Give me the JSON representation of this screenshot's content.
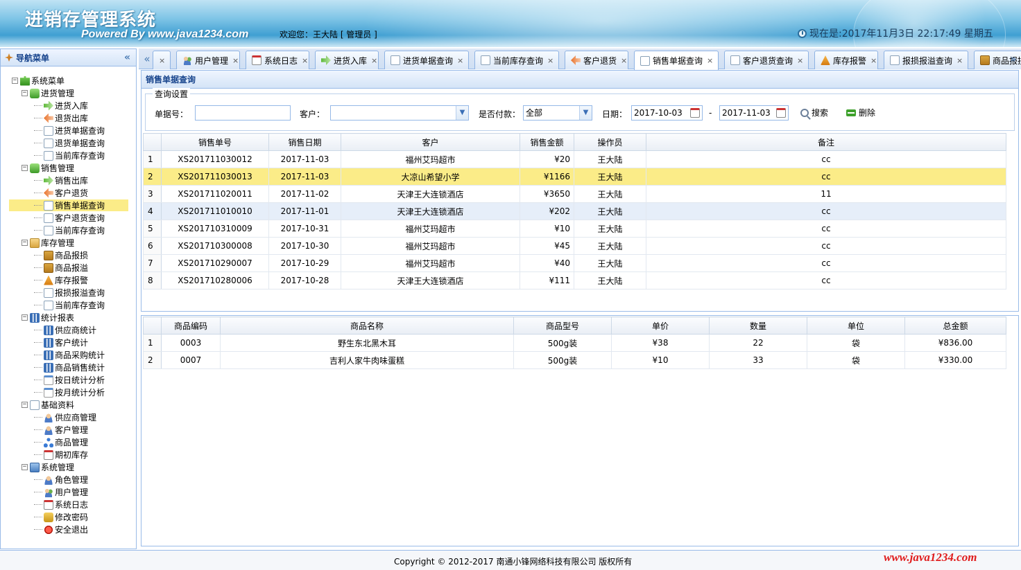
{
  "header": {
    "app_title": "进销存管理系统",
    "powered_by": "Powered By www.java1234.com",
    "welcome": "欢迎您：王大陆 [ 管理员 ]",
    "clock": "现在是:2017年11月3日 22:17:49 星期五"
  },
  "nav": {
    "title": "导航菜单",
    "collapse_icon": "«",
    "tree": [
      {
        "label": "系统菜单",
        "level": 0,
        "icon": "puzzle",
        "toggle": "⊟"
      },
      {
        "label": "进货管理",
        "level": 1,
        "icon": "green",
        "toggle": "⊟"
      },
      {
        "label": "进货入库",
        "level": 2,
        "icon": "in"
      },
      {
        "label": "退货出库",
        "level": 2,
        "icon": "out"
      },
      {
        "label": "进货单据查询",
        "level": 2,
        "icon": "doc"
      },
      {
        "label": "退货单据查询",
        "level": 2,
        "icon": "doc"
      },
      {
        "label": "当前库存查询",
        "level": 2,
        "icon": "doc"
      },
      {
        "label": "销售管理",
        "level": 1,
        "icon": "green",
        "toggle": "⊟"
      },
      {
        "label": "销售出库",
        "level": 2,
        "icon": "in"
      },
      {
        "label": "客户退货",
        "level": 2,
        "icon": "out"
      },
      {
        "label": "销售单据查询",
        "level": 2,
        "icon": "doc",
        "selected": true
      },
      {
        "label": "客户退货查询",
        "level": 2,
        "icon": "doc"
      },
      {
        "label": "当前库存查询",
        "level": 2,
        "icon": "doc"
      },
      {
        "label": "库存管理",
        "level": 1,
        "icon": "folder",
        "toggle": "⊟"
      },
      {
        "label": "商品报损",
        "level": 2,
        "icon": "pkg"
      },
      {
        "label": "商品报溢",
        "level": 2,
        "icon": "pkg"
      },
      {
        "label": "库存报警",
        "level": 2,
        "icon": "warn"
      },
      {
        "label": "报损报溢查询",
        "level": 2,
        "icon": "doc"
      },
      {
        "label": "当前库存查询",
        "level": 2,
        "icon": "doc"
      },
      {
        "label": "统计报表",
        "level": 1,
        "icon": "chart",
        "toggle": "⊟"
      },
      {
        "label": "供应商统计",
        "level": 2,
        "icon": "chart"
      },
      {
        "label": "客户统计",
        "level": 2,
        "icon": "chart"
      },
      {
        "label": "商品采购统计",
        "level": 2,
        "icon": "chart"
      },
      {
        "label": "商品销售统计",
        "level": 2,
        "icon": "chart"
      },
      {
        "label": "按日统计分析",
        "level": 2,
        "icon": "cal2"
      },
      {
        "label": "按月统计分析",
        "level": 2,
        "icon": "cal2"
      },
      {
        "label": "基础资料",
        "level": 1,
        "icon": "doc",
        "toggle": "⊟"
      },
      {
        "label": "供应商管理",
        "level": 2,
        "icon": "user"
      },
      {
        "label": "客户管理",
        "level": 2,
        "icon": "user"
      },
      {
        "label": "商品管理",
        "level": 2,
        "icon": "tree"
      },
      {
        "label": "期初库存",
        "level": 2,
        "icon": "calendar"
      },
      {
        "label": "系统管理",
        "level": 1,
        "icon": "pc",
        "toggle": "⊟"
      },
      {
        "label": "角色管理",
        "level": 2,
        "icon": "user"
      },
      {
        "label": "用户管理",
        "level": 2,
        "icon": "users"
      },
      {
        "label": "系统日志",
        "level": 2,
        "icon": "calendar"
      },
      {
        "label": "修改密码",
        "level": 2,
        "icon": "lock"
      },
      {
        "label": "安全退出",
        "level": 2,
        "icon": "exit"
      }
    ]
  },
  "tabs": {
    "scroll_left": "«",
    "scroll_right": "»",
    "items": [
      {
        "label": "×",
        "icon": "none"
      },
      {
        "label": "用户管理",
        "icon": "users"
      },
      {
        "label": "系统日志",
        "icon": "calendar"
      },
      {
        "label": "进货入库",
        "icon": "in"
      },
      {
        "label": "进货单据查询",
        "icon": "doc"
      },
      {
        "label": "当前库存查询",
        "icon": "doc"
      },
      {
        "label": "客户退货",
        "icon": "out"
      },
      {
        "label": "销售单据查询",
        "icon": "doc",
        "active": true
      },
      {
        "label": "客户退货查询",
        "icon": "doc"
      },
      {
        "label": "库存报警",
        "icon": "warn"
      },
      {
        "label": "报损报溢查询",
        "icon": "doc"
      },
      {
        "label": "商品报损",
        "icon": "pkg"
      }
    ]
  },
  "query": {
    "panel_title": "销售单据查询",
    "legend": "查询设置",
    "order_no_label": "单据号：",
    "order_no_value": "",
    "customer_label": "客户：",
    "customer_value": "",
    "paid_label": "是否付款：",
    "paid_value": "全部",
    "date_label": "日期：",
    "date_from": "2017-10-03",
    "date_sep": "-",
    "date_to": "2017-11-03",
    "search_label": "搜索",
    "delete_label": "删除"
  },
  "orders": {
    "columns": [
      "销售单号",
      "销售日期",
      "客户",
      "销售金额",
      "操作员",
      "备注"
    ],
    "rows": [
      {
        "n": "1",
        "no": "XS201711030012",
        "date": "2017-11-03",
        "customer": "福州艾玛超市",
        "amount": "¥20",
        "operator": "王大陆",
        "remark": "cc"
      },
      {
        "n": "2",
        "no": "XS201711030013",
        "date": "2017-11-03",
        "customer": "大凉山希望小学",
        "amount": "¥1166",
        "operator": "王大陆",
        "remark": "cc",
        "state": "hl"
      },
      {
        "n": "3",
        "no": "XS201711020011",
        "date": "2017-11-02",
        "customer": "天津王大连锁酒店",
        "amount": "¥3650",
        "operator": "王大陆",
        "remark": "11"
      },
      {
        "n": "4",
        "no": "XS201711010010",
        "date": "2017-11-01",
        "customer": "天津王大连锁酒店",
        "amount": "¥202",
        "operator": "王大陆",
        "remark": "cc",
        "state": "sel"
      },
      {
        "n": "5",
        "no": "XS201710310009",
        "date": "2017-10-31",
        "customer": "福州艾玛超市",
        "amount": "¥10",
        "operator": "王大陆",
        "remark": "cc"
      },
      {
        "n": "6",
        "no": "XS201710300008",
        "date": "2017-10-30",
        "customer": "福州艾玛超市",
        "amount": "¥45",
        "operator": "王大陆",
        "remark": "cc"
      },
      {
        "n": "7",
        "no": "XS201710290007",
        "date": "2017-10-29",
        "customer": "福州艾玛超市",
        "amount": "¥40",
        "operator": "王大陆",
        "remark": "cc"
      },
      {
        "n": "8",
        "no": "XS201710280006",
        "date": "2017-10-28",
        "customer": "天津王大连锁酒店",
        "amount": "¥111",
        "operator": "王大陆",
        "remark": "cc"
      }
    ]
  },
  "items": {
    "columns": [
      "商品编码",
      "商品名称",
      "商品型号",
      "单价",
      "数量",
      "单位",
      "总金额"
    ],
    "rows": [
      {
        "n": "1",
        "code": "0003",
        "name": "野生东北黑木耳",
        "model": "500g装",
        "price": "¥38",
        "qty": "22",
        "unit": "袋",
        "total": "¥836.00"
      },
      {
        "n": "2",
        "code": "0007",
        "name": "吉利人家牛肉味蛋糕",
        "model": "500g装",
        "price": "¥10",
        "qty": "33",
        "unit": "袋",
        "total": "¥330.00"
      }
    ]
  },
  "footer": {
    "copyright": "Copyright © 2012-2017 南通小锋网络科技有限公司 版权所有",
    "watermark": "www.java1234.com"
  }
}
